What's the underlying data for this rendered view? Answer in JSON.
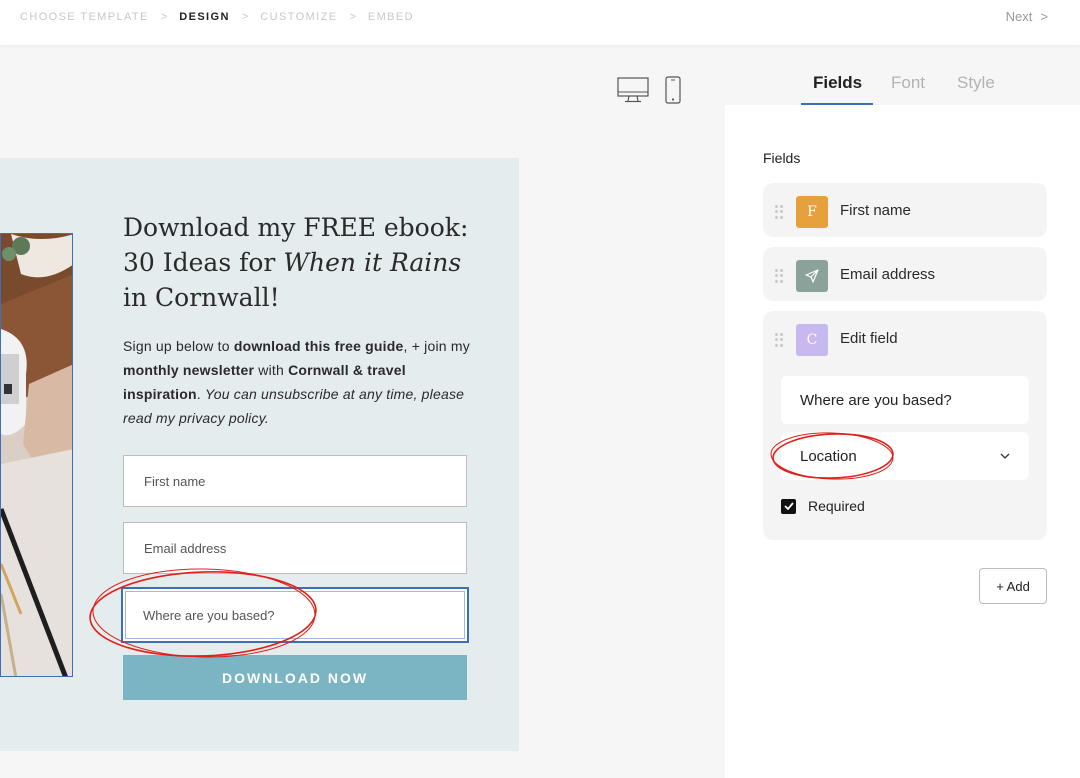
{
  "steps": [
    {
      "label": "CHOOSE TEMPLATE",
      "active": false
    },
    {
      "label": "DESIGN",
      "active": true
    },
    {
      "label": "CUSTOMIZE",
      "active": false
    },
    {
      "label": "EMBED",
      "active": false
    }
  ],
  "step_separator": ">",
  "next": {
    "label": "Next",
    "chevron": ">"
  },
  "device_icons": [
    "desktop-icon",
    "mobile-icon"
  ],
  "form": {
    "headline_line1": "Download my FREE ebook:",
    "headline_line2_plain": "30 Ideas for ",
    "headline_line2_italic": "When it Rains",
    "headline_line3": "in Cornwall!",
    "body": {
      "p1": "Sign up below to ",
      "b1": "download this free guide",
      "p2": ", + join my ",
      "b2": "monthly newsletter",
      "p3": " with ",
      "b3": "Cornwall & travel inspiration",
      "p4": ". ",
      "i1": "You can unsubscribe at any time, please read my privacy policy."
    },
    "inputs": [
      {
        "placeholder": "First name"
      },
      {
        "placeholder": "Email address"
      },
      {
        "placeholder": "Where are you based?"
      }
    ],
    "cta_label": "DOWNLOAD NOW"
  },
  "panel": {
    "tabs": [
      {
        "label": "Fields",
        "active": true
      },
      {
        "label": "Font",
        "active": false
      },
      {
        "label": "Style",
        "active": false
      }
    ],
    "fields_label": "Fields",
    "fields": [
      {
        "badge": "F",
        "name": "First name",
        "badge_color": "#e6a03c"
      },
      {
        "badge": "",
        "name": "Email address",
        "badge_color": "#8aa29a",
        "icon": "send-icon"
      },
      {
        "badge": "C",
        "name": "Edit field",
        "badge_color": "#c8b8f0"
      }
    ],
    "edit": {
      "label_value": "Where are you based?",
      "type_value": "Location",
      "required_label": "Required",
      "required_checked": true
    },
    "add_label": "+ Add"
  },
  "colors": {
    "accent": "#3d6fb8",
    "cta": "#7bb4c2",
    "card_bg": "#e5eced",
    "annotation": "#e0201b"
  }
}
